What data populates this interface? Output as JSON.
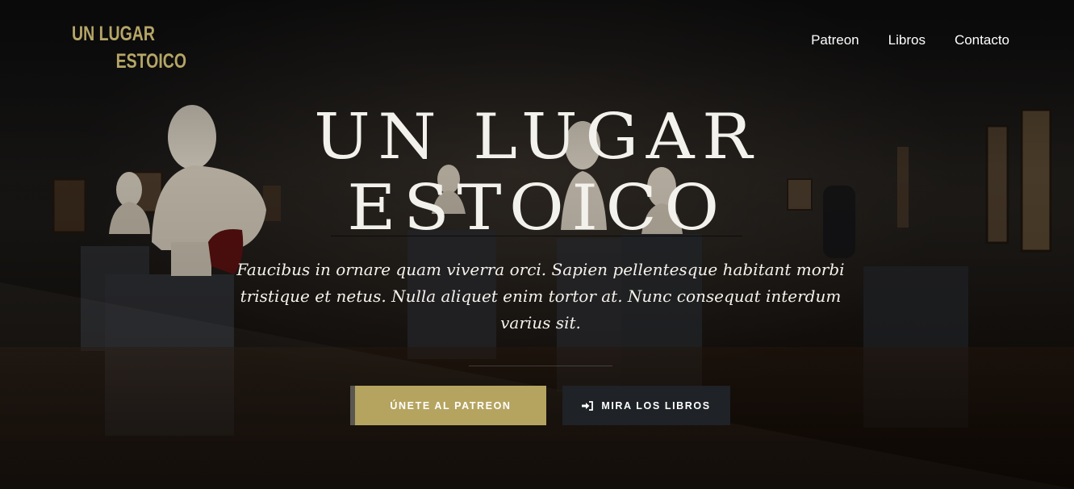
{
  "brand": {
    "logo_line1": "UN LUGAR",
    "logo_line2": "ESTOICO",
    "accent_color": "#b5a667"
  },
  "nav": {
    "items": [
      {
        "label": "Patreon"
      },
      {
        "label": "Libros"
      },
      {
        "label": "Contacto"
      }
    ]
  },
  "hero": {
    "title_line1": "UN LUGAR",
    "title_line2": "ESTOICO",
    "subtitle": "Faucibus in ornare quam viverra orci. Sapien pellentesque habitant morbi tristique et netus. Nulla aliquet enim tortor at. Nunc consequat interdum varius sit.",
    "background": "museum-busts-photo"
  },
  "buttons": {
    "primary_label": "ÚNETE AL PATREON",
    "primary_color": "#b5a45f",
    "secondary_label": "MIRA LOS LIBROS",
    "secondary_icon": "sign-in-icon",
    "secondary_color": "#1f2226"
  }
}
